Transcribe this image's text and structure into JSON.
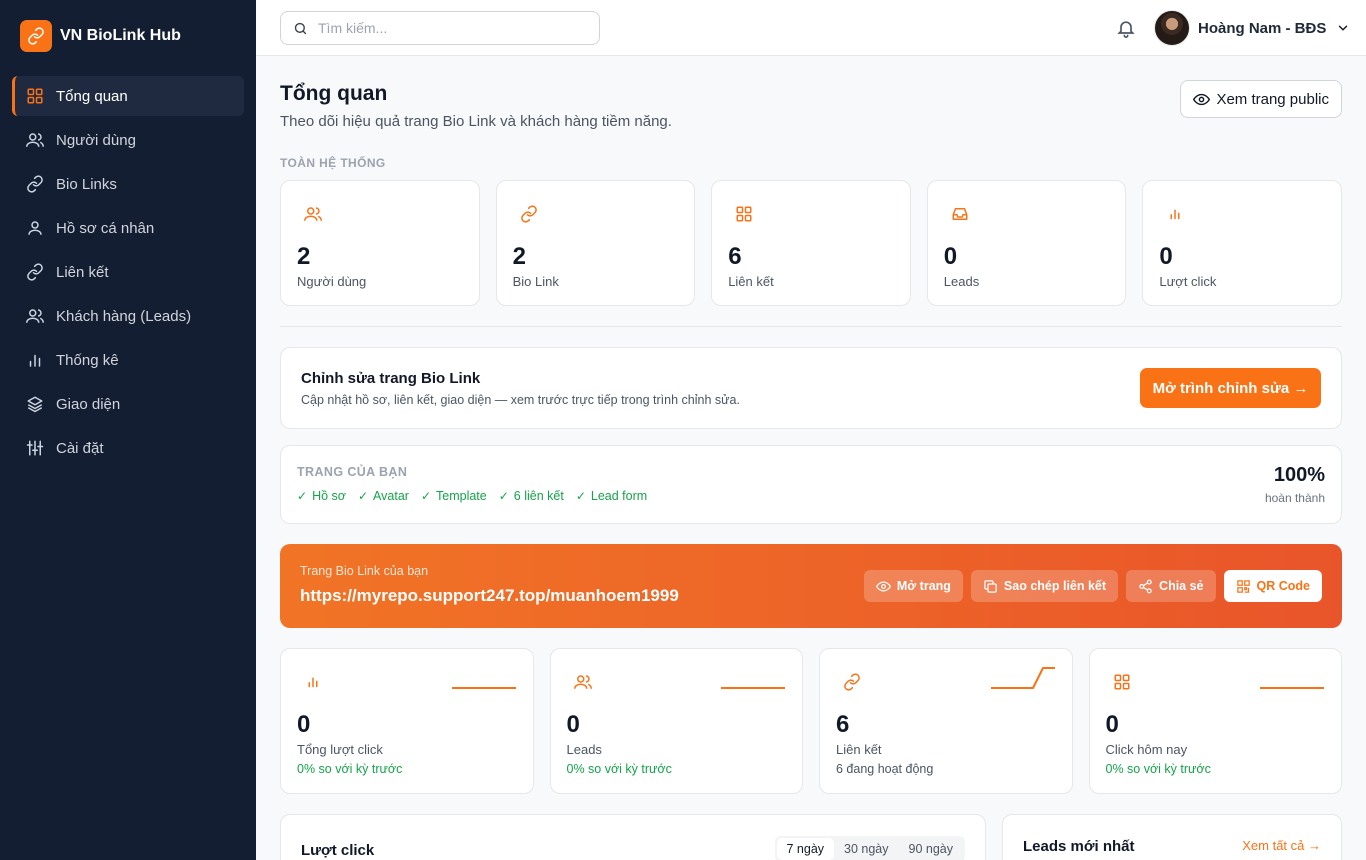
{
  "brand": {
    "name": "VN BioLink Hub",
    "icon": "link-icon",
    "accent": "#f97316"
  },
  "sidebar": {
    "items": [
      {
        "label": "Tổng quan",
        "icon": "grid-icon",
        "active": true
      },
      {
        "label": "Người dùng",
        "icon": "users-icon"
      },
      {
        "label": "Bio Links",
        "icon": "link-icon"
      },
      {
        "label": "Hồ sơ cá nhân",
        "icon": "user-icon"
      },
      {
        "label": "Liên kết",
        "icon": "link-icon"
      },
      {
        "label": "Khách hàng (Leads)",
        "icon": "users-icon"
      },
      {
        "label": "Thống kê",
        "icon": "bar-chart-icon"
      },
      {
        "label": "Giao diện",
        "icon": "layers-icon"
      },
      {
        "label": "Cài đặt",
        "icon": "sliders-icon"
      }
    ]
  },
  "topbar": {
    "search_placeholder": "Tìm kiếm...",
    "user_name": "Hoàng Nam - BĐS"
  },
  "header": {
    "title": "Tổng quan",
    "subtitle": "Theo dõi hiệu quả trang Bio Link và khách hàng tiềm năng.",
    "public_button": "Xem trang public"
  },
  "system": {
    "label": "TOÀN HỆ THỐNG",
    "stats": [
      {
        "value": "2",
        "label": "Người dùng",
        "icon": "users-icon"
      },
      {
        "value": "2",
        "label": "Bio Link",
        "icon": "link-icon"
      },
      {
        "value": "6",
        "label": "Liên kết",
        "icon": "grid-icon"
      },
      {
        "value": "0",
        "label": "Leads",
        "icon": "inbox-icon"
      },
      {
        "value": "0",
        "label": "Lượt click",
        "icon": "bar-chart-icon"
      }
    ]
  },
  "editor": {
    "title": "Chỉnh sửa trang Bio Link",
    "description": "Cập nhật hồ sơ, liên kết, giao diện — xem trước trực tiếp trong trình chỉnh sửa.",
    "button": "Mở trình chỉnh sửa →"
  },
  "progress": {
    "label": "TRANG CỦA BẠN",
    "checks": [
      "Hồ sơ",
      "Avatar",
      "Template",
      "6 liên kết",
      "Lead form"
    ],
    "percent": "100%",
    "percent_caption": "hoàn thành",
    "check_color": "#16a34a"
  },
  "link_banner": {
    "caption": "Trang Bio Link của bạn",
    "url": "https://myrepo.support247.top/muanhoem1999",
    "buttons": [
      "Mở trang",
      "Sao chép liên kết",
      "Chia sẻ",
      "QR Code"
    ]
  },
  "kpis": [
    {
      "value": "0",
      "label": "Tổng lượt click",
      "delta": "0% so với kỳ trước",
      "icon": "bar-chart-icon"
    },
    {
      "value": "0",
      "label": "Leads",
      "delta": "0% so với kỳ trước",
      "icon": "users-icon"
    },
    {
      "value": "6",
      "label": "Liên kết",
      "delta": "6 đang hoạt động",
      "icon": "link-icon"
    },
    {
      "value": "0",
      "label": "Click hôm nay",
      "delta": "0% so với kỳ trước",
      "icon": "grid-icon"
    }
  ],
  "clicks": {
    "title": "Lượt click",
    "ranges": [
      "7 ngày",
      "30 ngày",
      "90 ngày"
    ],
    "selected_range": "7 ngày"
  },
  "leads": {
    "title": "Leads mới nhất",
    "view_all": "Xem tất cả →"
  }
}
